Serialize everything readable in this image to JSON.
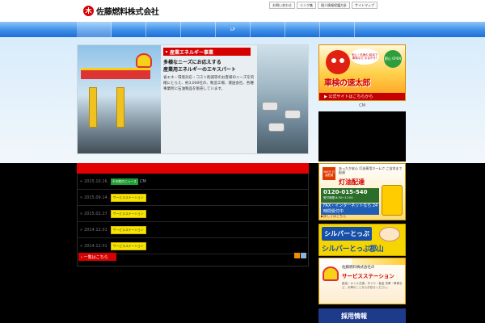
{
  "header": {
    "logo_mark": "木",
    "company_name": "佐藤燃料株式会社",
    "links": [
      "お問い合わせ",
      "リンク集",
      "個人情報保護方針",
      "サイトマップ"
    ]
  },
  "nav": {
    "items": [
      "",
      "",
      "",
      "",
      "LP",
      "",
      "",
      ""
    ]
  },
  "hero": {
    "title": "産業エネルギー事業",
    "catch_line1": "多様なニーズにお応えする",
    "catch_line2": "産業用エネルギーのエキスパート",
    "body": "省エネ・環境対応・コスト削減等のお客様のニーズを的確にとらえ、約3,000社の、製造工場、運送会社、各種事業所に石油製品を販売しています。"
  },
  "sidebar": {
    "mascot_banner": {
      "bubble": "安心・迅速の 給油で 車検なら おまかせ!",
      "badge": "郡山 OPEN",
      "title": "車検の速太郎",
      "link": "▶ 公式サイトはこちらから"
    },
    "cm_label": "CM",
    "kerosene_banner": {
      "badge": "365日 灯油配達",
      "top_text": "あったか安心 灯油専用ホームで ご自宅まで配達",
      "title": "灯油配達",
      "phone": "0120-015-540",
      "phone_note": "受付時間 8:30〜17:00",
      "fax": "FAX・インターネットなら 24時間受付中",
      "more": "▶詳しくはこちら"
    },
    "silver_banner": {
      "top": "シルバーとっぷ",
      "bottom": "シルバーとっぷ郡山"
    },
    "ss_banner": {
      "company": "佐藤燃料株式会社の",
      "title": "サービスステーション",
      "desc": "給油・オイル交換・タイヤ・板金 洗車・車検など、お車のことならお任せください。"
    },
    "recruit_banner": {
      "title": "採用情報"
    }
  },
  "news": {
    "items": [
      {
        "date": "2015.10.16",
        "tag": "その他のニュース",
        "tag_color": "green",
        "title": "CM"
      },
      {
        "date": "2015.09.14",
        "tag": "サービスステーション",
        "tag_color": "yellow",
        "title": ""
      },
      {
        "date": "2015.02.27",
        "tag": "サービスステーション",
        "tag_color": "yellow",
        "title": ""
      },
      {
        "date": "2014.12.01",
        "tag": "サービスステーション",
        "tag_color": "yellow",
        "title": ""
      },
      {
        "date": "2014.12.01",
        "tag": "サービスステーション",
        "tag_color": "yellow",
        "title": ""
      }
    ],
    "list_button": "› 一覧はこちら"
  },
  "colors": {
    "brand_red": "#d60000",
    "nav_blue": "#3d8ee8",
    "tag_green": "#1e9d36",
    "tag_yellow": "#f7e400"
  }
}
